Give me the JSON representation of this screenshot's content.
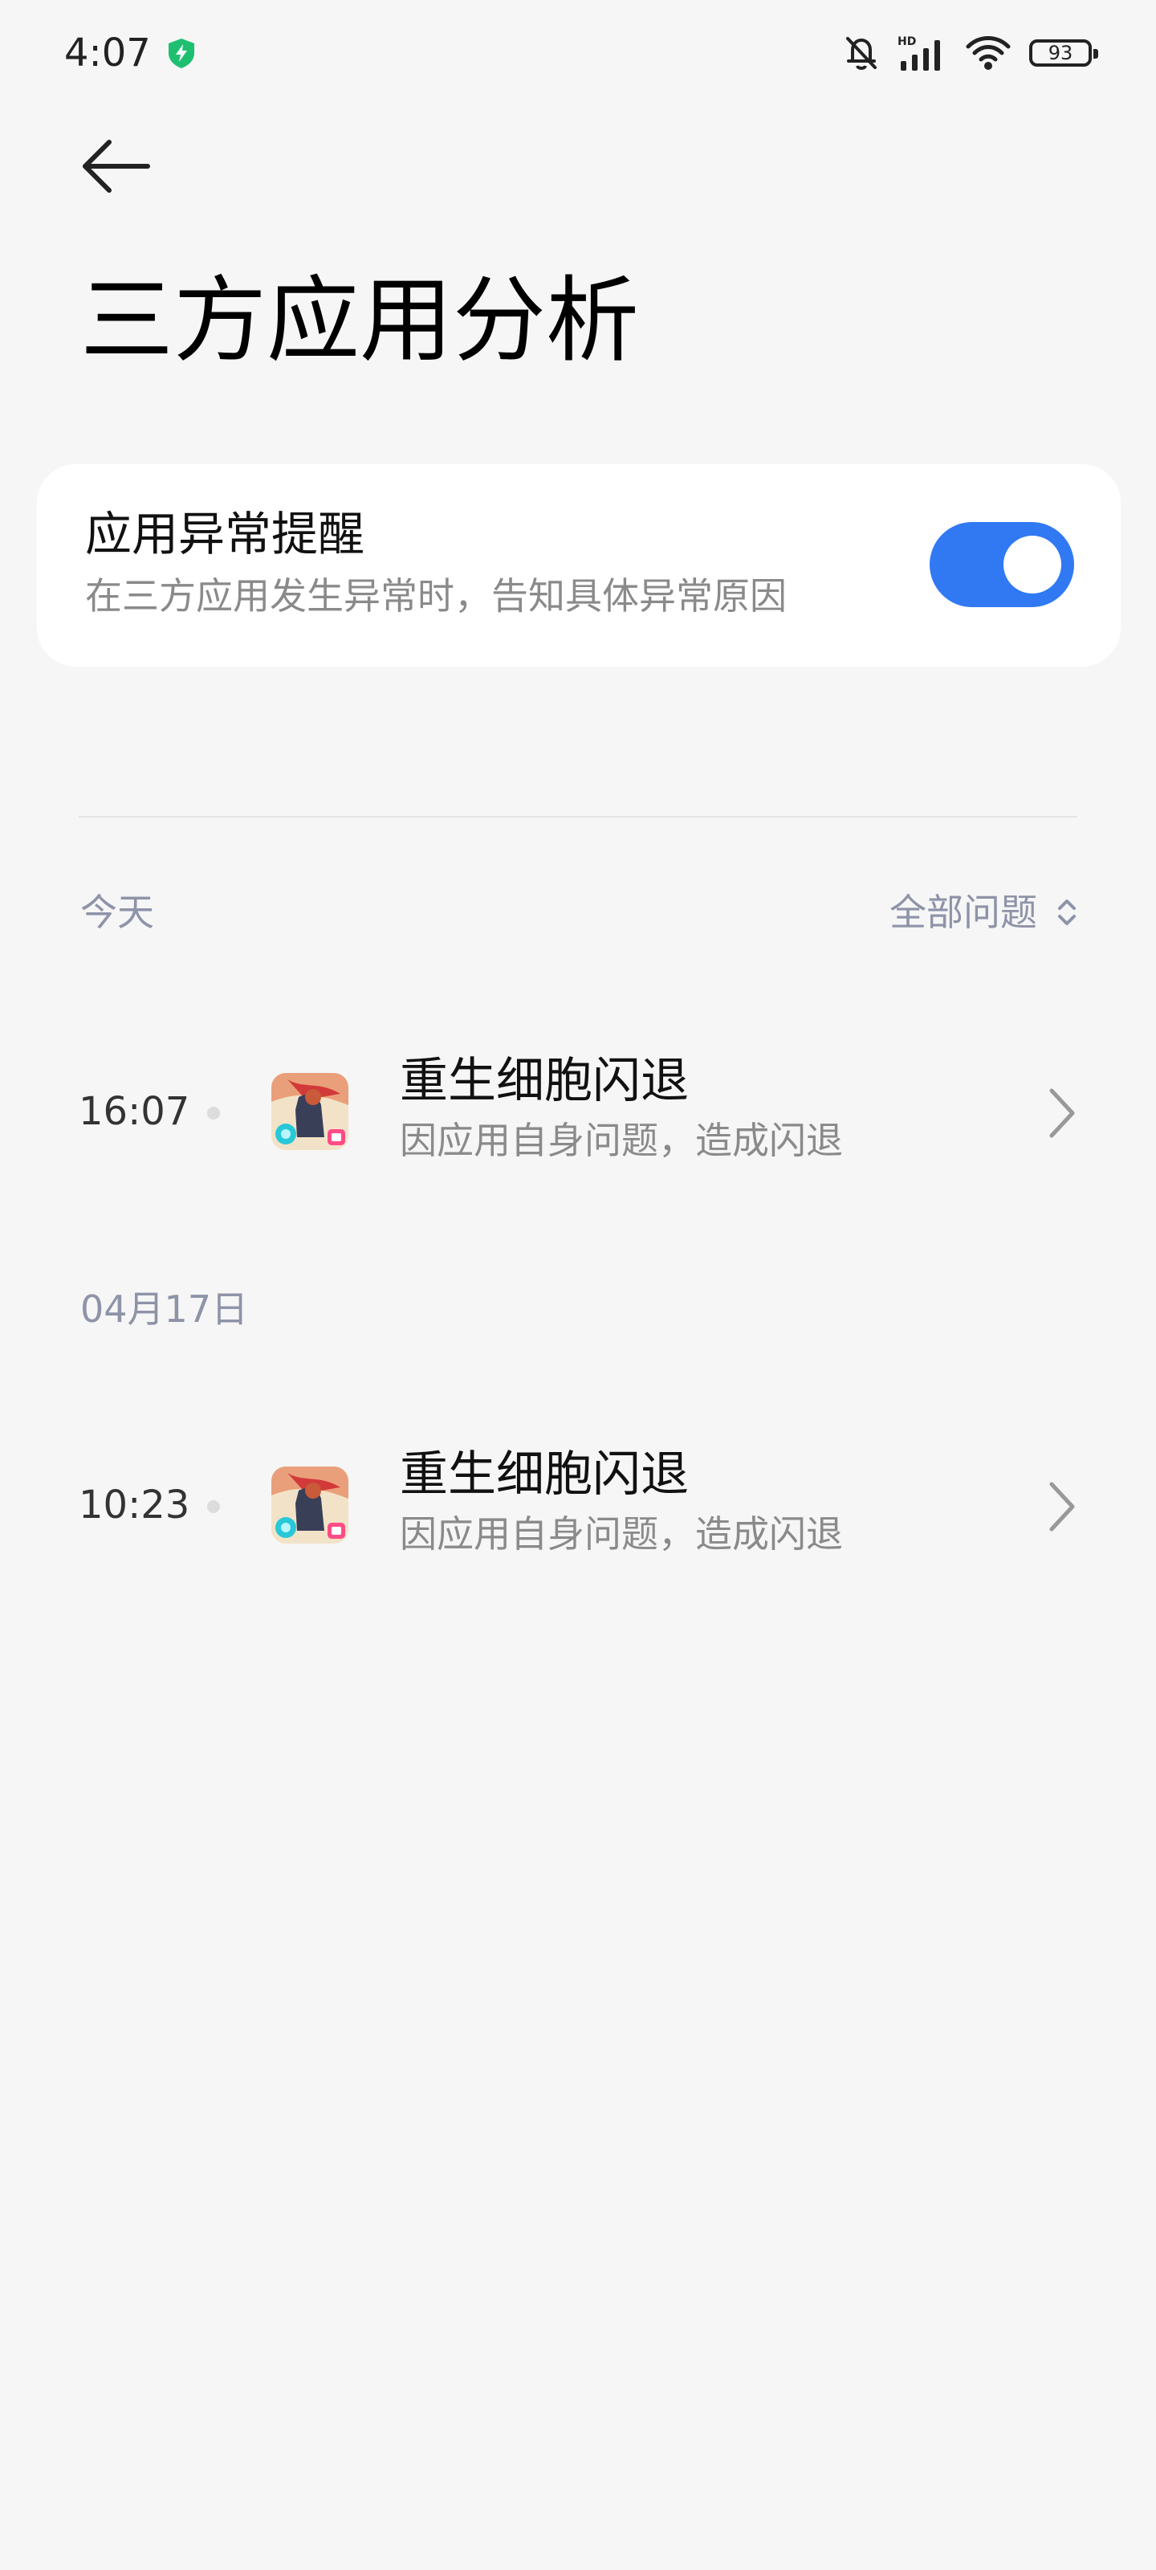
{
  "status_bar": {
    "time": "4:07",
    "battery": "93",
    "icons": [
      "shield-charging-icon",
      "bell-muted-icon",
      "signal-hd-icon",
      "wifi-icon",
      "battery-icon"
    ]
  },
  "header": {
    "back_icon": "back-arrow-icon",
    "title": "三方应用分析"
  },
  "settings_card": {
    "title": "应用异常提醒",
    "subtitle": "在三方应用发生异常时，告知具体异常原因",
    "toggle_on": true,
    "accent": "#3179f3"
  },
  "filter": {
    "label": "全部问题",
    "icon": "sort-updown-icon"
  },
  "sections": [
    {
      "label": "今天",
      "items": [
        {
          "time": "16:07",
          "title": "重生细胞闪退",
          "subtitle": "因应用自身问题，造成闪退"
        }
      ]
    },
    {
      "label": "04月17日",
      "items": [
        {
          "time": "10:23",
          "title": "重生细胞闪退",
          "subtitle": "因应用自身问题，造成闪退"
        }
      ]
    }
  ]
}
